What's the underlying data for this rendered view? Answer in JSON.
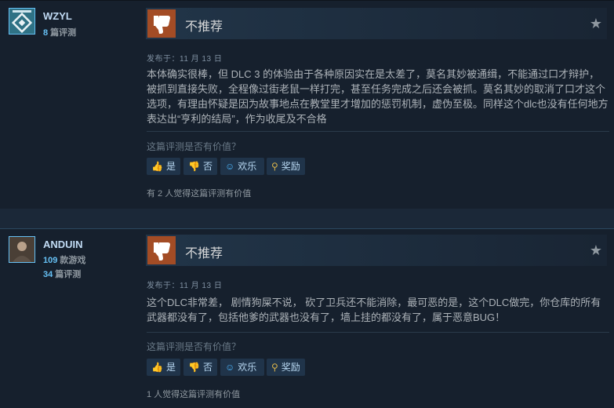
{
  "reviews": [
    {
      "persona_name": "WZYL",
      "stats": [
        {
          "num": "8",
          "label": " 篇评测"
        }
      ],
      "verdict": "不推荐",
      "posted": "发布于：11 月 13 日",
      "content": "本体确实很棒，但 DLC 3 的体验由于各种原因实在是太差了，莫名其妙被通缉，不能通过口才辩护，被抓到直接失败，全程像过街老鼠一样打完，甚至任务完成之后还会被抓。莫名其妙的取消了口才这个选项，有理由怀疑是因为故事地点在教堂里才增加的惩罚机制，虚伪至极。同样这个dlc也没有任何地方表达出“亨利的结局”，作为收尾及不合格",
      "question": "这篇评测是否有价值？",
      "buttons": {
        "yes": "是",
        "no": "否",
        "funny": "欢乐",
        "award": "奖励"
      },
      "helpful": "有 2 人觉得这篇评测有价值"
    },
    {
      "persona_name": "ANDUIN",
      "stats": [
        {
          "num": "109",
          "label": " 款游戏"
        },
        {
          "num": "34",
          "label": " 篇评测"
        }
      ],
      "verdict": "不推荐",
      "posted": "发布于：11 月 13 日",
      "content": "这个DLC非常差，  剧情狗屎不说，  砍了卫兵还不能消除，最可恶的是，这个DLC做完，你仓库的所有武器都没有了，包括他爹的武器也没有了，墙上挂的都没有了，属于恶意BUG！",
      "question": "这篇评测是否有价值？",
      "buttons": {
        "yes": "是",
        "no": "否",
        "funny": "欢乐",
        "award": "奖励"
      },
      "helpful": "1 人觉得这篇评测有价值"
    }
  ],
  "icons": {
    "thumbs_down": "thumbs-down-icon",
    "star": "star-icon",
    "thumbs_up_small": "thumbs-up-icon",
    "smile": "smile-icon",
    "award": "award-icon"
  },
  "colors": {
    "background": "#1b2838",
    "card_bg": "#16202d",
    "thumb_down_bg": "#a34c25",
    "link_blue": "#66c0f4"
  }
}
